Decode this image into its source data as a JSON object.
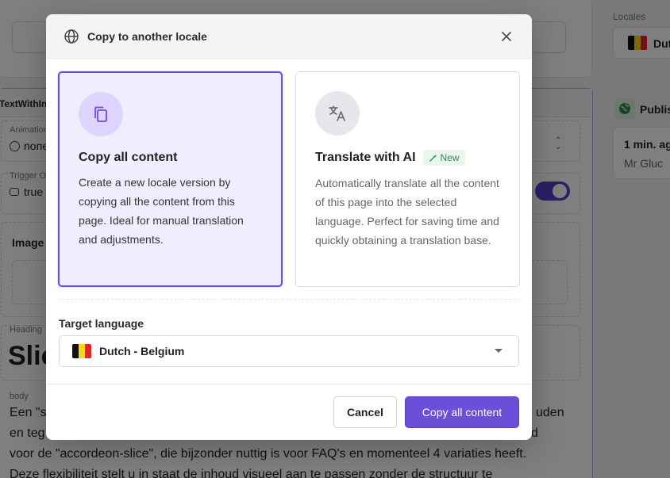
{
  "background": {
    "locales_label": "Locales",
    "locale_value": "Dut",
    "publish_label": "Publis",
    "last_edit": "1 min. ag",
    "author": "Mr Gluc",
    "component_label": "TextWithIn",
    "animation_label": "Animation",
    "animation_value": "none",
    "trigger_label": "Trigger O",
    "trigger_value": "true",
    "image_label": "Image",
    "heading_label": "Heading",
    "heading_value": "Slic",
    "body_label": "body",
    "body_line1": "Een \"s",
    "body_line1_end": "uden",
    "body_line2": "en teg",
    "body_line2_end": "d",
    "body_line3": "voor de \"accordeon-slice\", die bijzonder nuttig is voor FAQ's en momenteel 4 variaties heeft.",
    "body_line4": "Deze flexibiliteit stelt u in staat de inhoud visueel aan te passen zonder de structuur te"
  },
  "modal": {
    "title": "Copy to another locale",
    "options": [
      {
        "title": "Copy all content",
        "description": "Create a new locale version by copying all the content from this page. Ideal for manual translation and adjustments.",
        "selected": true,
        "icon": "copy-icon"
      },
      {
        "title": "Translate with AI",
        "badge": "New",
        "description": "Automatically translate all the content of this page into the selected language. Perfect for saving time and quickly obtaining a translation base.",
        "selected": false,
        "icon": "translate-icon"
      }
    ],
    "target_language_label": "Target language",
    "target_language_value": "Dutch - Belgium",
    "cancel_label": "Cancel",
    "confirm_label": "Copy all content"
  },
  "colors": {
    "accent": "#6b4fd8",
    "selected_bg": "#f1edff",
    "badge_bg": "#e8f6ee",
    "badge_text": "#2a8a55"
  }
}
